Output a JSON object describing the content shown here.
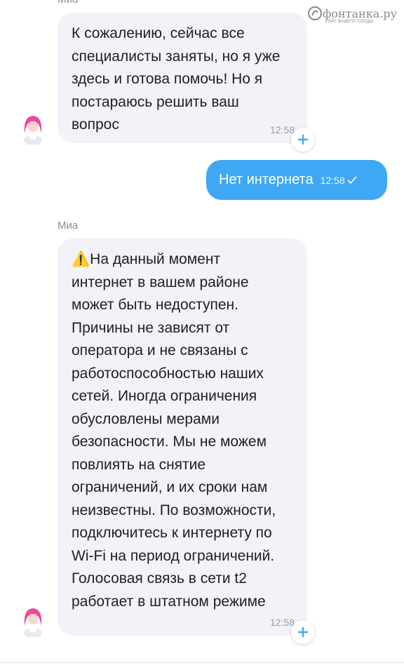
{
  "header": {
    "sender_top": "Миа",
    "watermark": "фонтанка.ру",
    "watermark_sub": "САЙТ ВАШЕГО ГОРОДА"
  },
  "messages": [
    {
      "direction": "incoming",
      "text": "К сожалению, сейчас все\nспециалисты заняты, но я уже\nздесь и готова помочь! Но я\nпостараюсь решить ваш\nвопрос",
      "time": "12:58"
    },
    {
      "direction": "outgoing",
      "text": "Нет интернета",
      "time": "12:58",
      "status": "check-icon"
    },
    {
      "direction": "incoming",
      "sender": "Миа",
      "text": "⚠️На данный момент\nинтернет в вашем районе\nможет быть недоступен.\nПричины не зависят от\nоператора и не связаны с\nработоспособностью наших\nсетей. Иногда ограничения\nобусловлены мерами\nбезопасности. Мы не можем\nповлиять на снятие\nограничений, и их сроки нам\nнеизвестны. По возможности,\nподключитесь к интернету по\nWi-Fi на период ограничений.\nГолосовая связь в сети t2\nработает в штатном режиме",
      "time": "12:58"
    }
  ],
  "colors": {
    "outgoing_bubble": "#3fa8f5",
    "incoming_bubble": "#f2f3f8",
    "add_button_icon": "#3fa8f5",
    "avatar_hair": "#f0489a"
  }
}
